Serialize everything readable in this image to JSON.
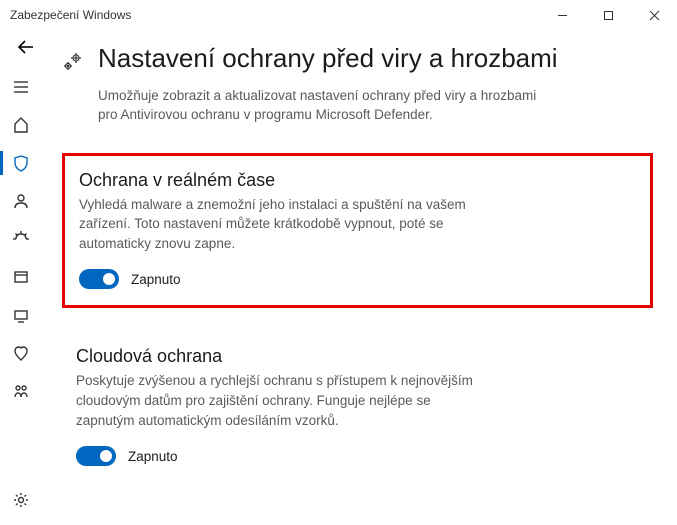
{
  "window": {
    "title": "Zabezpečení Windows"
  },
  "page": {
    "title": "Nastavení ochrany před viry a hrozbami",
    "subtitle": "Umožňuje zobrazit a aktualizovat nastavení ochrany před viry a hrozbami pro Antivirovou ochranu v programu Microsoft Defender."
  },
  "sections": {
    "realtime": {
      "title": "Ochrana v reálném čase",
      "desc": "Vyhledá malware a znemožní jeho instalaci a spuštění na vašem zařízení. Toto nastavení můžete krátkodobě vypnout, poté se automaticky znovu zapne.",
      "toggle_state": "Zapnuto"
    },
    "cloud": {
      "title": "Cloudová ochrana",
      "desc": "Poskytuje zvýšenou a rychlejší ochranu s přístupem k nejnovějším cloudovým datům pro zajištění ochrany. Funguje nejlépe se zapnutým automatickým odesíláním vzorků.",
      "toggle_state": "Zapnuto"
    }
  },
  "nav": {
    "items": [
      "menu",
      "home",
      "virus",
      "account",
      "firewall",
      "app-browser",
      "device-security",
      "device-performance",
      "family"
    ],
    "selected": "virus"
  }
}
